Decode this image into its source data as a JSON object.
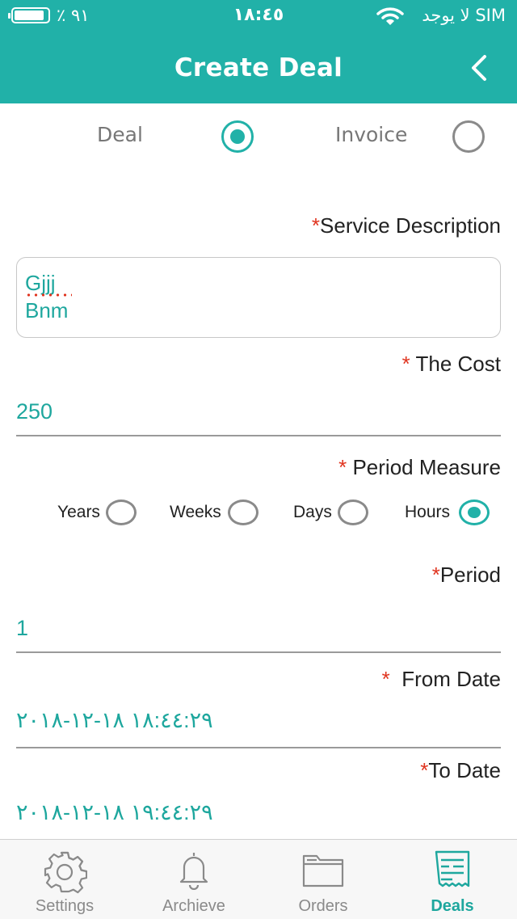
{
  "status_bar": {
    "battery_text": "٪ ٩١",
    "time": "١٨:٤٥",
    "carrier": "لا يوجد SIM",
    "battery_level": 0.91
  },
  "header": {
    "title": "Create Deal",
    "back_icon": "chevron-back-icon",
    "color": "#21b1a8"
  },
  "type_selector": {
    "options": [
      {
        "label": "Deal",
        "selected": true
      },
      {
        "label": "Invoice",
        "selected": false
      }
    ]
  },
  "service_description": {
    "required_mark": "*",
    "label": "Service Description",
    "value_lines": [
      "Gjjj",
      "Bnm"
    ]
  },
  "cost": {
    "required_mark": "*",
    "label": "The Cost",
    "value": "250"
  },
  "period_measure": {
    "required_mark": "*",
    "label": "Period Measure",
    "options": [
      {
        "label": "Years",
        "selected": false
      },
      {
        "label": "Weeks",
        "selected": false
      },
      {
        "label": "Days",
        "selected": false
      },
      {
        "label": "Hours",
        "selected": true
      }
    ]
  },
  "period": {
    "required_mark": "*",
    "label": "Period",
    "value": "1"
  },
  "from_date": {
    "required_mark": "*",
    "label": "From Date",
    "value": "١٨:٤٤:٢٩ ١٨-١٢-٢٠١٨"
  },
  "to_date": {
    "required_mark": "*",
    "label": "To Date",
    "value": "١٩:٤٤:٢٩ ١٨-١٢-٢٠١٨"
  },
  "tabbar": {
    "tabs": [
      {
        "label": "Settings",
        "icon": "gear-icon",
        "active": false
      },
      {
        "label": "Archieve",
        "icon": "bell-icon",
        "active": false
      },
      {
        "label": "Orders",
        "icon": "folder-icon",
        "active": false
      },
      {
        "label": "Deals",
        "icon": "receipt-icon",
        "active": true
      }
    ],
    "active_color": "#1ea79e",
    "inactive_color": "#8a8a8a"
  }
}
